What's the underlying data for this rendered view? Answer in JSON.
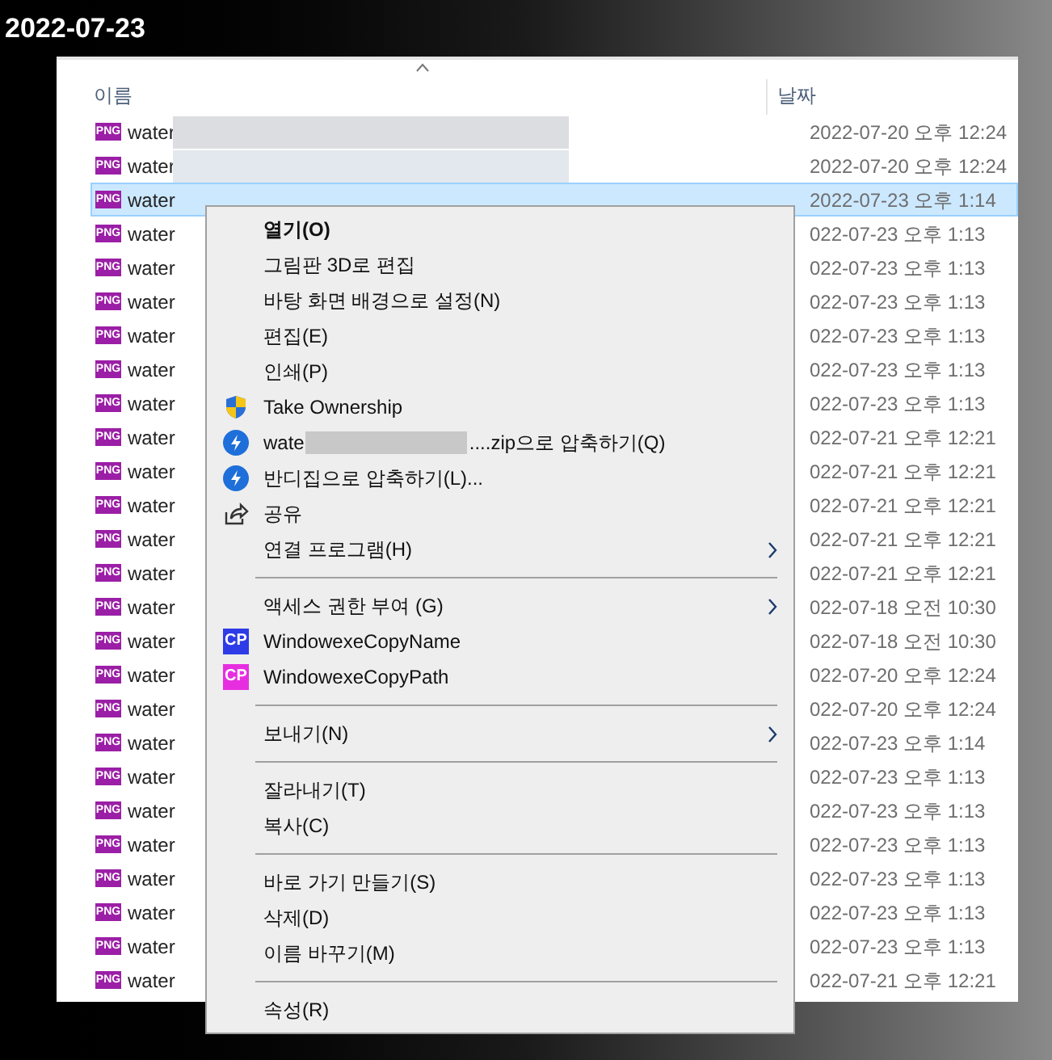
{
  "title": "2022-07-23",
  "columns": [
    {
      "label": "이름"
    },
    {
      "label": "날짜"
    }
  ],
  "files": [
    {
      "name": "water",
      "date": "2022-07-20 오후 12:24",
      "selected": false
    },
    {
      "name": "water",
      "date": "2022-07-20 오후 12:24",
      "selected": false
    },
    {
      "name": "water",
      "date": "2022-07-23 오후 1:14",
      "selected": true
    },
    {
      "name": "water",
      "date": "022-07-23 오후 1:13",
      "selected": false
    },
    {
      "name": "water",
      "date": "022-07-23 오후 1:13",
      "selected": false
    },
    {
      "name": "water",
      "date": "022-07-23 오후 1:13",
      "selected": false
    },
    {
      "name": "water",
      "date": "022-07-23 오후 1:13",
      "selected": false
    },
    {
      "name": "water",
      "date": "022-07-23 오후 1:13",
      "selected": false
    },
    {
      "name": "water",
      "date": "022-07-23 오후 1:13",
      "selected": false
    },
    {
      "name": "water",
      "date": "022-07-21 오후 12:21",
      "selected": false
    },
    {
      "name": "water",
      "date": "022-07-21 오후 12:21",
      "selected": false
    },
    {
      "name": "water",
      "date": "022-07-21 오후 12:21",
      "selected": false
    },
    {
      "name": "water",
      "date": "022-07-21 오후 12:21",
      "selected": false
    },
    {
      "name": "water",
      "date": "022-07-21 오후 12:21",
      "selected": false
    },
    {
      "name": "water",
      "date": "022-07-18 오전 10:30",
      "selected": false
    },
    {
      "name": "water",
      "date": "022-07-18 오전 10:30",
      "selected": false
    },
    {
      "name": "water",
      "date": "022-07-20 오후 12:24",
      "selected": false
    },
    {
      "name": "water",
      "date": "022-07-20 오후 12:24",
      "selected": false
    },
    {
      "name": "water",
      "date": "022-07-23 오후 1:14",
      "selected": false
    },
    {
      "name": "water",
      "date": "022-07-23 오후 1:13",
      "selected": false
    },
    {
      "name": "water",
      "date": "022-07-23 오후 1:13",
      "selected": false
    },
    {
      "name": "water",
      "date": "022-07-23 오후 1:13",
      "selected": false
    },
    {
      "name": "water",
      "date": "022-07-23 오후 1:13",
      "selected": false
    },
    {
      "name": "water",
      "date": "022-07-23 오후 1:13",
      "selected": false
    },
    {
      "name": "water",
      "date": "022-07-23 오후 1:13",
      "selected": false
    },
    {
      "name": "water",
      "date": "022-07-21 오후 12:21",
      "selected": false
    }
  ],
  "file_icons": [
    "PNG",
    "PNG",
    "PNG",
    "PNG",
    "PNG",
    "PNG",
    "PNG",
    "PNG",
    "PNG",
    "PNG",
    "PNG",
    "PNG",
    "PNG",
    "PNG",
    "PNG",
    "PNG",
    "PNG",
    "PNG",
    "PNG",
    "PNG",
    "PNG",
    "PNG",
    "PNG",
    "PNG",
    "PNG",
    "PNG"
  ],
  "context_menu": [
    {
      "kind": "item",
      "label": "열기(O)",
      "bold": true
    },
    {
      "kind": "item",
      "label": "그림판 3D로 편집"
    },
    {
      "kind": "item",
      "label": "바탕 화면 배경으로 설정(N)"
    },
    {
      "kind": "item",
      "label": "편집(E)"
    },
    {
      "kind": "item",
      "label": "인쇄(P)"
    },
    {
      "kind": "item",
      "label": "Take Ownership",
      "icon": {
        "kind": "shield"
      }
    },
    {
      "kind": "blurred",
      "label": "wate",
      "suffix": "....zip으로 압축하기(Q)",
      "icon": {
        "kind": "bolt"
      }
    },
    {
      "kind": "item",
      "label": "반디집으로 압축하기(L)...",
      "icon": {
        "kind": "bolt"
      }
    },
    {
      "kind": "item",
      "label": "공유",
      "icon": {
        "kind": "share"
      }
    },
    {
      "kind": "item",
      "label": "연결 프로그램(H)",
      "submenu": true
    },
    {
      "kind": "separator"
    },
    {
      "kind": "item",
      "label": "액세스 권한 부여 (G)",
      "submenu": true
    },
    {
      "kind": "item",
      "label": "WindowexeCopyName",
      "icon": {
        "kind": "badge",
        "text": "CP",
        "color": "#2d3ce6"
      }
    },
    {
      "kind": "item",
      "label": "WindowexeCopyPath",
      "icon": {
        "kind": "badge",
        "text": "CP",
        "color": "#e62ee0"
      }
    },
    {
      "kind": "separator"
    },
    {
      "kind": "item",
      "label": "보내기(N)",
      "submenu": true
    },
    {
      "kind": "separator"
    },
    {
      "kind": "item",
      "label": "잘라내기(T)"
    },
    {
      "kind": "item",
      "label": "복사(C)"
    },
    {
      "kind": "separator"
    },
    {
      "kind": "item",
      "label": "바로 가기 만들기(S)"
    },
    {
      "kind": "item",
      "label": "삭제(D)"
    },
    {
      "kind": "item",
      "label": "이름 바꾸기(M)"
    },
    {
      "kind": "separator"
    },
    {
      "kind": "item",
      "label": "속성(R)"
    }
  ]
}
